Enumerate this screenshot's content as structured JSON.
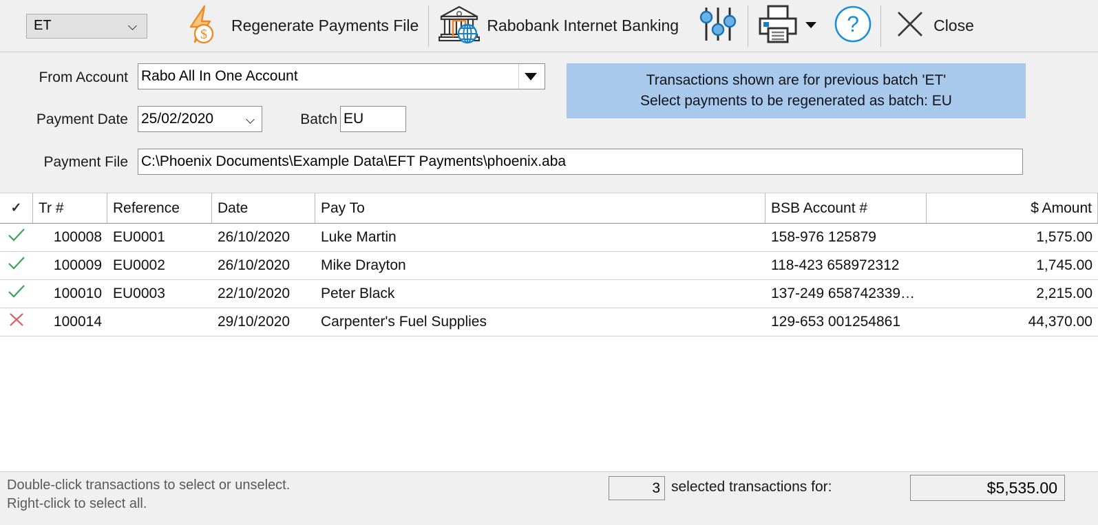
{
  "toolbar": {
    "batch_combo": {
      "value": "ET",
      "icon": "chevron-down-icon"
    },
    "regenerate_button": {
      "label": "Regenerate Payments File",
      "icon": "lightning-dollar-icon"
    },
    "internet_banking_button": {
      "label": "Rabobank Internet Banking",
      "icon": "bank-globe-icon"
    },
    "settings_button": {
      "label": "",
      "icon": "sliders-icon"
    },
    "print_button": {
      "label": "",
      "icon": "printer-icon"
    },
    "print_dropdown": {
      "icon": "caret-down-icon"
    },
    "help_button": {
      "label": "",
      "icon": "question-circle-icon"
    },
    "close_button": {
      "label": "Close",
      "icon": "close-x-icon"
    }
  },
  "form": {
    "from_account_label": "From Account",
    "from_account_value": "Rabo All In One Account",
    "payment_date_label": "Payment Date",
    "payment_date_value": "25/02/2020",
    "batch_label": "Batch",
    "batch_value": "EU",
    "payment_file_label": "Payment File",
    "payment_file_value": "C:\\Phoenix Documents\\Example Data\\EFT Payments\\phoenix.aba"
  },
  "info_banner": {
    "line1": "Transactions shown are for previous batch 'ET'",
    "line2": "Select payments to be regenerated as batch: EU",
    "bg_color": "#a8c8ec"
  },
  "table": {
    "columns": [
      "✓",
      "Tr #",
      "Reference",
      "Date",
      "Pay To",
      "BSB Account #",
      "$ Amount"
    ],
    "rows": [
      {
        "selected": true,
        "mark": "check",
        "tr": "100008",
        "reference": "EU0001",
        "date": "26/10/2020",
        "pay_to": "Luke Martin",
        "bsb": "158-976 125879",
        "amount": "1,575.00"
      },
      {
        "selected": true,
        "mark": "check",
        "tr": "100009",
        "reference": "EU0002",
        "date": "26/10/2020",
        "pay_to": "Mike Drayton",
        "bsb": "118-423 658972312",
        "amount": "1,745.00"
      },
      {
        "selected": true,
        "mark": "check",
        "tr": "100010",
        "reference": "EU0003",
        "date": "22/10/2020",
        "pay_to": "Peter Black",
        "bsb": "137-249 658742339…",
        "amount": "2,215.00"
      },
      {
        "selected": false,
        "mark": "cross",
        "tr": "100014",
        "reference": "",
        "date": "29/10/2020",
        "pay_to": "Carpenter's Fuel Supplies",
        "bsb": "129-653 001254861",
        "amount": "44,370.00"
      }
    ],
    "check_color": "#3aa35a",
    "cross_color": "#e0565b"
  },
  "footer": {
    "hint_line1": "Double-click transactions to select or unselect.",
    "hint_line2": "Right-click to select all.",
    "selected_count": "3",
    "selected_label": "selected transactions for:",
    "total_amount": "$5,535.00"
  }
}
